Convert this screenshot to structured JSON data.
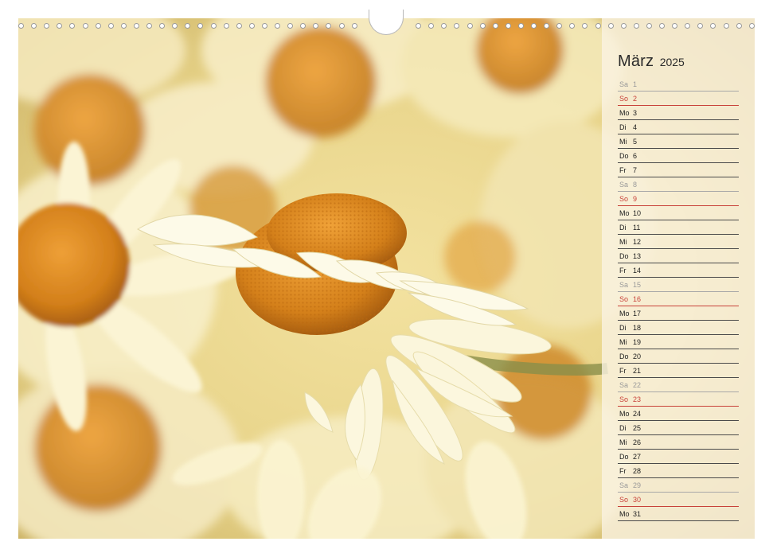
{
  "calendar": {
    "month": "März",
    "year": "2025",
    "days": [
      {
        "wd": "Sa",
        "d": "1",
        "type": "sat"
      },
      {
        "wd": "So",
        "d": "2",
        "type": "sun"
      },
      {
        "wd": "Mo",
        "d": "3",
        "type": "wk"
      },
      {
        "wd": "Di",
        "d": "4",
        "type": "wk"
      },
      {
        "wd": "Mi",
        "d": "5",
        "type": "wk"
      },
      {
        "wd": "Do",
        "d": "6",
        "type": "wk"
      },
      {
        "wd": "Fr",
        "d": "7",
        "type": "wk"
      },
      {
        "wd": "Sa",
        "d": "8",
        "type": "sat"
      },
      {
        "wd": "So",
        "d": "9",
        "type": "sun"
      },
      {
        "wd": "Mo",
        "d": "10",
        "type": "wk"
      },
      {
        "wd": "Di",
        "d": "11",
        "type": "wk"
      },
      {
        "wd": "Mi",
        "d": "12",
        "type": "wk"
      },
      {
        "wd": "Do",
        "d": "13",
        "type": "wk"
      },
      {
        "wd": "Fr",
        "d": "14",
        "type": "wk"
      },
      {
        "wd": "Sa",
        "d": "15",
        "type": "sat"
      },
      {
        "wd": "So",
        "d": "16",
        "type": "sun"
      },
      {
        "wd": "Mo",
        "d": "17",
        "type": "wk"
      },
      {
        "wd": "Di",
        "d": "18",
        "type": "wk"
      },
      {
        "wd": "Mi",
        "d": "19",
        "type": "wk"
      },
      {
        "wd": "Do",
        "d": "20",
        "type": "wk"
      },
      {
        "wd": "Fr",
        "d": "21",
        "type": "wk"
      },
      {
        "wd": "Sa",
        "d": "22",
        "type": "sat"
      },
      {
        "wd": "So",
        "d": "23",
        "type": "sun"
      },
      {
        "wd": "Mo",
        "d": "24",
        "type": "wk"
      },
      {
        "wd": "Di",
        "d": "25",
        "type": "wk"
      },
      {
        "wd": "Mi",
        "d": "26",
        "type": "wk"
      },
      {
        "wd": "Do",
        "d": "27",
        "type": "wk"
      },
      {
        "wd": "Fr",
        "d": "28",
        "type": "wk"
      },
      {
        "wd": "Sa",
        "d": "29",
        "type": "sat"
      },
      {
        "wd": "So",
        "d": "30",
        "type": "sun"
      },
      {
        "wd": "Mo",
        "d": "31",
        "type": "wk"
      }
    ]
  },
  "colors": {
    "sunday": "#c8423a",
    "saturday": "#9a9a9a",
    "weekday": "#1e1e1e",
    "flower_center": "#d98a1c",
    "petal": "#f8f0c8"
  },
  "photo": {
    "subject": "chamomile-flowers"
  }
}
